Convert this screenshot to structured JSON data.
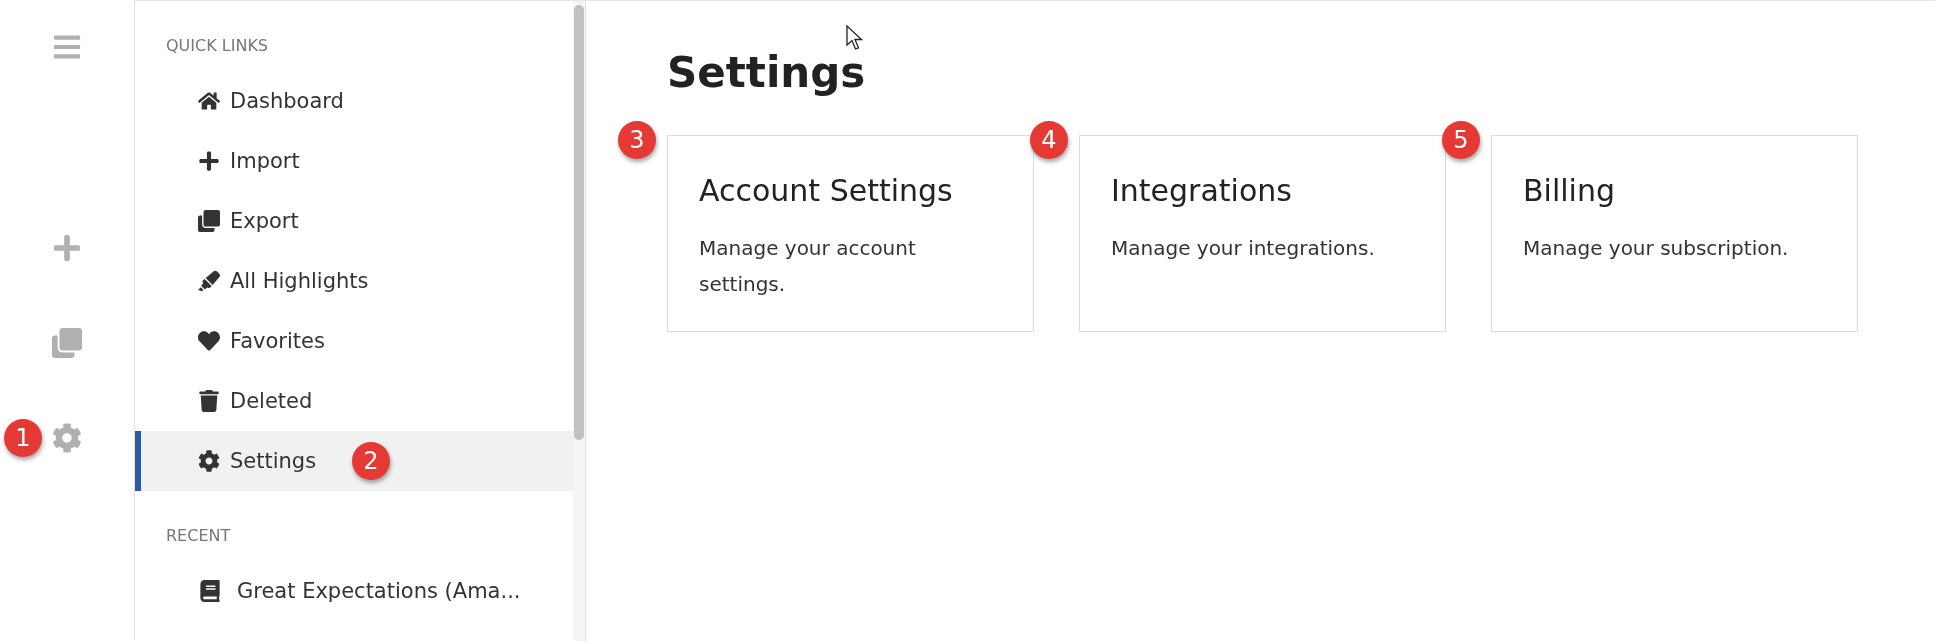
{
  "rail": {
    "items": [
      {
        "kind": "menu"
      },
      {
        "kind": "add"
      },
      {
        "kind": "copy"
      },
      {
        "kind": "settings",
        "badge": "1"
      }
    ]
  },
  "sidebar": {
    "sections": [
      {
        "title": "QUICK LINKS",
        "items": [
          {
            "label": "Dashboard",
            "kind": "home",
            "selected": false
          },
          {
            "label": "Import",
            "kind": "add",
            "selected": false
          },
          {
            "label": "Export",
            "kind": "copy",
            "selected": false
          },
          {
            "label": "All Highlights",
            "kind": "highlighter",
            "selected": false
          },
          {
            "label": "Favorites",
            "kind": "heart",
            "selected": false
          },
          {
            "label": "Deleted",
            "kind": "trash",
            "selected": false
          },
          {
            "label": "Settings",
            "kind": "settings",
            "selected": true,
            "badge": "2"
          }
        ]
      },
      {
        "title": "RECENT",
        "items": [
          {
            "label": "Great Expectations (Ama...",
            "kind": "book",
            "selected": false
          }
        ]
      }
    ]
  },
  "main": {
    "title": "Settings",
    "cards": [
      {
        "title": "Account Settings",
        "description": "Manage your account settings.",
        "badge": "3"
      },
      {
        "title": "Integrations",
        "description": "Manage your integrations.",
        "badge": "4"
      },
      {
        "title": "Billing",
        "description": "Manage your subscription.",
        "badge": "5"
      }
    ]
  }
}
